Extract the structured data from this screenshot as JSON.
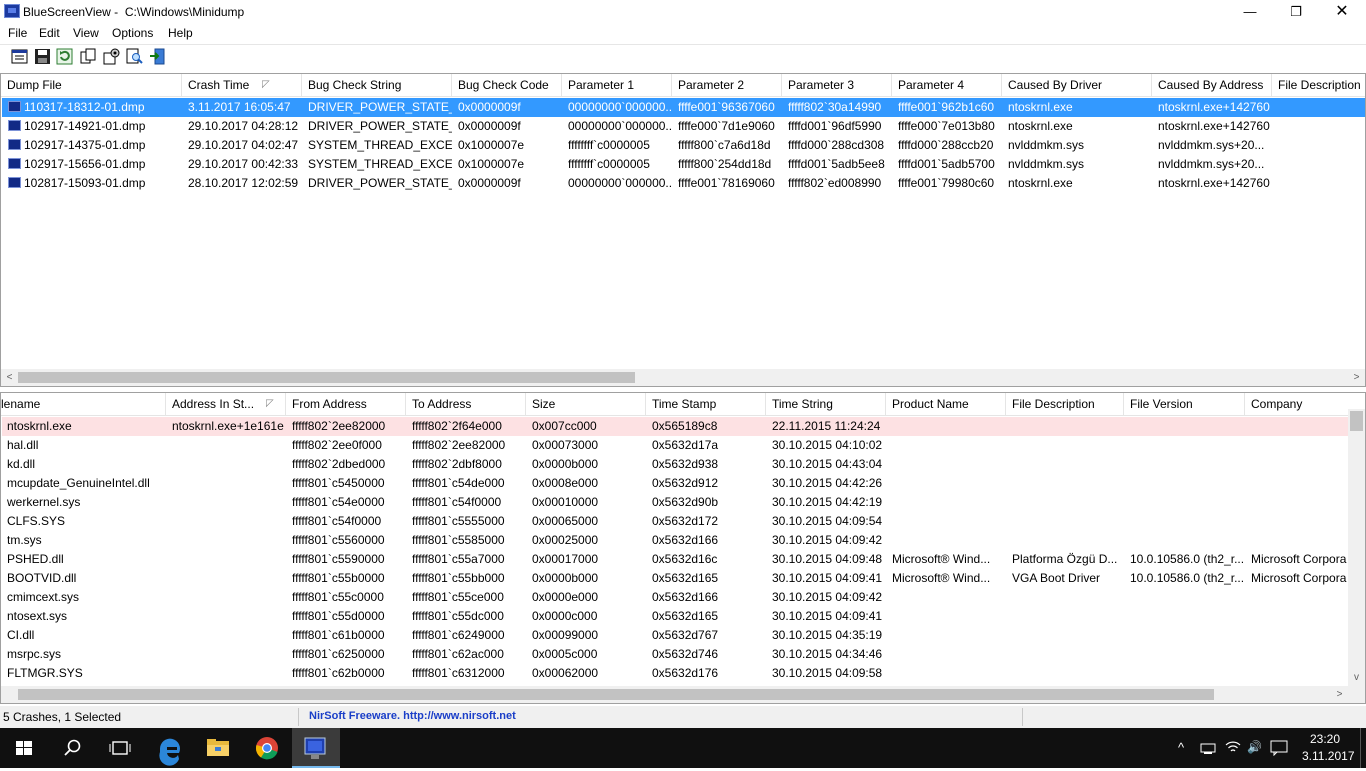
{
  "window": {
    "app_name": "BlueScreenView",
    "path": "C:\\Windows\\Minidump",
    "minimize_glyph": "—",
    "maximize_glyph": "❐",
    "close_glyph": "✕"
  },
  "menu": [
    "File",
    "Edit",
    "View",
    "Options",
    "Help"
  ],
  "toolbar_icons": [
    "properties-icon",
    "save-icon",
    "refresh-icon",
    "copy-icon",
    "options-icon",
    "find-icon",
    "exit-icon"
  ],
  "upper": {
    "columns": [
      "Dump File",
      "Crash Time",
      "Bug Check String",
      "Bug Check Code",
      "Parameter 1",
      "Parameter 2",
      "Parameter 3",
      "Parameter 4",
      "Caused By Driver",
      "Caused By Address",
      "File Description"
    ],
    "sort_glyph": "◸",
    "rows": [
      [
        "110317-18312-01.dmp",
        "3.11.2017 16:05:47",
        "DRIVER_POWER_STATE_...",
        "0x0000009f",
        "00000000`000000...",
        "ffffe001`96367060",
        "fffff802`30a14990",
        "ffffe001`962b1c60",
        "ntoskrnl.exe",
        "ntoskrnl.exe+142760",
        ""
      ],
      [
        "102917-14921-01.dmp",
        "29.10.2017 04:28:12",
        "DRIVER_POWER_STATE_...",
        "0x0000009f",
        "00000000`000000...",
        "ffffe000`7d1e9060",
        "ffffd001`96df5990",
        "ffffe000`7e013b80",
        "ntoskrnl.exe",
        "ntoskrnl.exe+142760",
        ""
      ],
      [
        "102917-14375-01.dmp",
        "29.10.2017 04:02:47",
        "SYSTEM_THREAD_EXCE...",
        "0x1000007e",
        "ffffffff`c0000005",
        "fffff800`c7a6d18d",
        "ffffd000`288cd308",
        "ffffd000`288ccb20",
        "nvlddmkm.sys",
        "nvlddmkm.sys+20...",
        ""
      ],
      [
        "102917-15656-01.dmp",
        "29.10.2017 00:42:33",
        "SYSTEM_THREAD_EXCE...",
        "0x1000007e",
        "ffffffff`c0000005",
        "fffff800`254dd18d",
        "ffffd001`5adb5ee8",
        "ffffd001`5adb5700",
        "nvlddmkm.sys",
        "nvlddmkm.sys+20...",
        ""
      ],
      [
        "102817-15093-01.dmp",
        "28.10.2017 12:02:59",
        "DRIVER_POWER_STATE_...",
        "0x0000009f",
        "00000000`000000...",
        "ffffe001`78169060",
        "fffff802`ed008990",
        "ffffe001`79980c60",
        "ntoskrnl.exe",
        "ntoskrnl.exe+142760",
        ""
      ]
    ]
  },
  "lower": {
    "columns": [
      "lename",
      "Address In St...",
      "From Address",
      "To Address",
      "Size",
      "Time Stamp",
      "Time String",
      "Product Name",
      "File Description",
      "File Version",
      "Company"
    ],
    "sort_glyph": "◸",
    "rows": [
      [
        "ntoskrnl.exe",
        "ntoskrnl.exe+1e161e",
        "fffff802`2ee82000",
        "fffff802`2f64e000",
        "0x007cc000",
        "0x565189c8",
        "22.11.2015 11:24:24",
        "",
        "",
        "",
        ""
      ],
      [
        "hal.dll",
        "",
        "fffff802`2ee0f000",
        "fffff802`2ee82000",
        "0x00073000",
        "0x5632d17a",
        "30.10.2015 04:10:02",
        "",
        "",
        "",
        ""
      ],
      [
        "kd.dll",
        "",
        "fffff802`2dbed000",
        "fffff802`2dbf8000",
        "0x0000b000",
        "0x5632d938",
        "30.10.2015 04:43:04",
        "",
        "",
        "",
        ""
      ],
      [
        "mcupdate_GenuineIntel.dll",
        "",
        "fffff801`c5450000",
        "fffff801`c54de000",
        "0x0008e000",
        "0x5632d912",
        "30.10.2015 04:42:26",
        "",
        "",
        "",
        ""
      ],
      [
        "werkernel.sys",
        "",
        "fffff801`c54e0000",
        "fffff801`c54f0000",
        "0x00010000",
        "0x5632d90b",
        "30.10.2015 04:42:19",
        "",
        "",
        "",
        ""
      ],
      [
        "CLFS.SYS",
        "",
        "fffff801`c54f0000",
        "fffff801`c5555000",
        "0x00065000",
        "0x5632d172",
        "30.10.2015 04:09:54",
        "",
        "",
        "",
        ""
      ],
      [
        "tm.sys",
        "",
        "fffff801`c5560000",
        "fffff801`c5585000",
        "0x00025000",
        "0x5632d166",
        "30.10.2015 04:09:42",
        "",
        "",
        "",
        ""
      ],
      [
        "PSHED.dll",
        "",
        "fffff801`c5590000",
        "fffff801`c55a7000",
        "0x00017000",
        "0x5632d16c",
        "30.10.2015 04:09:48",
        "Microsoft® Wind...",
        "Platforma Özgü D...",
        "10.0.10586.0 (th2_r...",
        "Microsoft Corpora"
      ],
      [
        "BOOTVID.dll",
        "",
        "fffff801`c55b0000",
        "fffff801`c55bb000",
        "0x0000b000",
        "0x5632d165",
        "30.10.2015 04:09:41",
        "Microsoft® Wind...",
        "VGA Boot Driver",
        "10.0.10586.0 (th2_r...",
        "Microsoft Corpora"
      ],
      [
        "cmimcext.sys",
        "",
        "fffff801`c55c0000",
        "fffff801`c55ce000",
        "0x0000e000",
        "0x5632d166",
        "30.10.2015 04:09:42",
        "",
        "",
        "",
        ""
      ],
      [
        "ntosext.sys",
        "",
        "fffff801`c55d0000",
        "fffff801`c55dc000",
        "0x0000c000",
        "0x5632d165",
        "30.10.2015 04:09:41",
        "",
        "",
        "",
        ""
      ],
      [
        "CI.dll",
        "",
        "fffff801`c61b0000",
        "fffff801`c6249000",
        "0x00099000",
        "0x5632d767",
        "30.10.2015 04:35:19",
        "",
        "",
        "",
        ""
      ],
      [
        "msrpc.sys",
        "",
        "fffff801`c6250000",
        "fffff801`c62ac000",
        "0x0005c000",
        "0x5632d746",
        "30.10.2015 04:34:46",
        "",
        "",
        "",
        ""
      ],
      [
        "FLTMGR.SYS",
        "",
        "fffff801`c62b0000",
        "fffff801`c6312000",
        "0x00062000",
        "0x5632d176",
        "30.10.2015 04:09:58",
        "",
        "",
        "",
        ""
      ]
    ]
  },
  "scroll": {
    "left_glyph": "<",
    "right_glyph": ">",
    "up_glyph": "^",
    "down_glyph": "v"
  },
  "status": {
    "selection": "5 Crashes, 1 Selected",
    "credit": "NirSoft Freeware.  http://www.nirsoft.net"
  },
  "taskbar": {
    "items": [
      "windows-start-icon",
      "search-icon",
      "task-view-icon",
      "edge-icon",
      "file-explorer-icon",
      "chrome-icon",
      "bluescreenview-icon"
    ],
    "tray_glyphs": {
      "chevron": "^",
      "volume": "🔊"
    },
    "time": "23:20",
    "date": "3.11.2017"
  },
  "colors": {
    "selection": "#3399ff",
    "highlight_row": "#fde1e3",
    "credit_text": "#1a3ec8",
    "taskbar": "#101010"
  }
}
